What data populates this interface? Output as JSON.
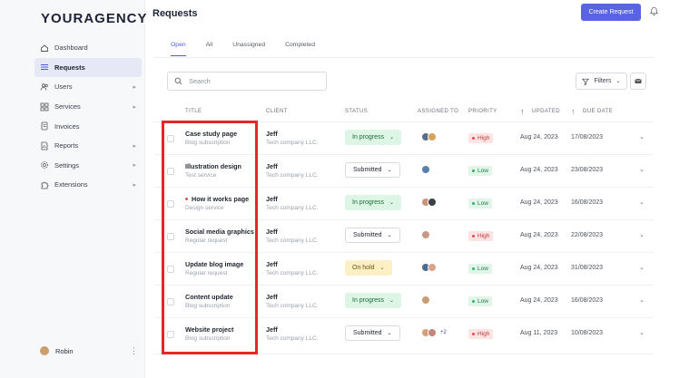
{
  "app": {
    "logo": "YOURAGENCY"
  },
  "sidebar": {
    "items": [
      {
        "label": "Dashboard",
        "icon": "home-icon",
        "active": false,
        "chevron": ""
      },
      {
        "label": "Requests",
        "icon": "list-icon",
        "active": true,
        "chevron": ""
      },
      {
        "label": "Users",
        "icon": "users-icon",
        "active": false,
        "chevron": "▸"
      },
      {
        "label": "Services",
        "icon": "grid-icon",
        "active": false,
        "chevron": "▸"
      },
      {
        "label": "Invoices",
        "icon": "invoice-icon",
        "active": false,
        "chevron": ""
      },
      {
        "label": "Reports",
        "icon": "report-icon",
        "active": false,
        "chevron": "▸"
      },
      {
        "label": "Settings",
        "icon": "gear-icon",
        "active": false,
        "chevron": "▸"
      },
      {
        "label": "Extensions",
        "icon": "puzzle-icon",
        "active": false,
        "chevron": "▸"
      }
    ],
    "user": {
      "name": "Robin"
    }
  },
  "header": {
    "title": "Requests",
    "create_label": "Create Request"
  },
  "tabs": [
    "Open",
    "All",
    "Unassigned",
    "Completed"
  ],
  "toolbar": {
    "search_placeholder": "Search",
    "filters_label": "Filters"
  },
  "table": {
    "columns": {
      "title": "TITLE",
      "client": "CLIENT",
      "status": "STATUS",
      "assigned": "ASSIGNED TO",
      "priority": "PRIORITY",
      "updated": "UPDATED",
      "due": "DUE DATE"
    },
    "rows": [
      {
        "title": "Case study page",
        "subtitle": "Blog subscription",
        "client": "Jeff",
        "company": "Tech company LLC.",
        "status": "In progress",
        "status_kind": "prog",
        "avatars": [
          "#5c6b8a",
          "#d6a35c"
        ],
        "extra": "",
        "priority": "High",
        "priority_kind": "high",
        "updated": "Aug 24, 2023",
        "due": "17/08/2023",
        "dot": false
      },
      {
        "title": "Illustration design",
        "subtitle": "Test service",
        "client": "Jeff",
        "company": "Tech company LLC.",
        "status": "Submitted",
        "status_kind": "sub",
        "avatars": [
          "#5b7fa8"
        ],
        "extra": "",
        "priority": "Low",
        "priority_kind": "low",
        "updated": "Aug 24, 2023",
        "due": "23/08/2023",
        "dot": false
      },
      {
        "title": "How it works page",
        "subtitle": "Design service",
        "client": "Jeff",
        "company": "Tech company LLC.",
        "status": "In progress",
        "status_kind": "prog",
        "avatars": [
          "#c9947a",
          "#3c3f46"
        ],
        "extra": "",
        "priority": "Low",
        "priority_kind": "low",
        "updated": "Aug 24, 2023",
        "due": "16/08/2023",
        "dot": true
      },
      {
        "title": "Social media graphics",
        "subtitle": "Regular request",
        "client": "Jeff",
        "company": "Tech company LLC.",
        "status": "Submitted",
        "status_kind": "sub",
        "avatars": [
          "#c49a86"
        ],
        "extra": "",
        "priority": "High",
        "priority_kind": "high",
        "updated": "Aug 24, 2023",
        "due": "22/08/2023",
        "dot": false
      },
      {
        "title": "Update blog image",
        "subtitle": "Regular request",
        "client": "Jeff",
        "company": "Tech company LLC.",
        "status": "On hold",
        "status_kind": "hold",
        "avatars": [
          "#4d6b8f",
          "#d9a48a"
        ],
        "extra": "",
        "priority": "Low",
        "priority_kind": "low",
        "updated": "Aug 24, 2023",
        "due": "31/08/2023",
        "dot": false
      },
      {
        "title": "Content update",
        "subtitle": "Blog subscription",
        "client": "Jeff",
        "company": "Tech company LLC.",
        "status": "In progress",
        "status_kind": "prog",
        "avatars": [
          "#c99b73"
        ],
        "extra": "",
        "priority": "Low",
        "priority_kind": "low",
        "updated": "Aug 24, 2023",
        "due": "16/08/2023",
        "dot": false
      },
      {
        "title": "Website project",
        "subtitle": "Blog subscription",
        "client": "Jeff",
        "company": "Tech company LLC.",
        "status": "Submitted",
        "status_kind": "sub",
        "avatars": [
          "#d4a07a",
          "#c8867a"
        ],
        "extra": "+2",
        "priority": "High",
        "priority_kind": "high",
        "updated": "Aug 11, 2023",
        "due": "10/08/2023",
        "dot": false
      }
    ]
  },
  "colors": {
    "accent": "#5a63e6",
    "highlight_box": "#e8252a"
  }
}
